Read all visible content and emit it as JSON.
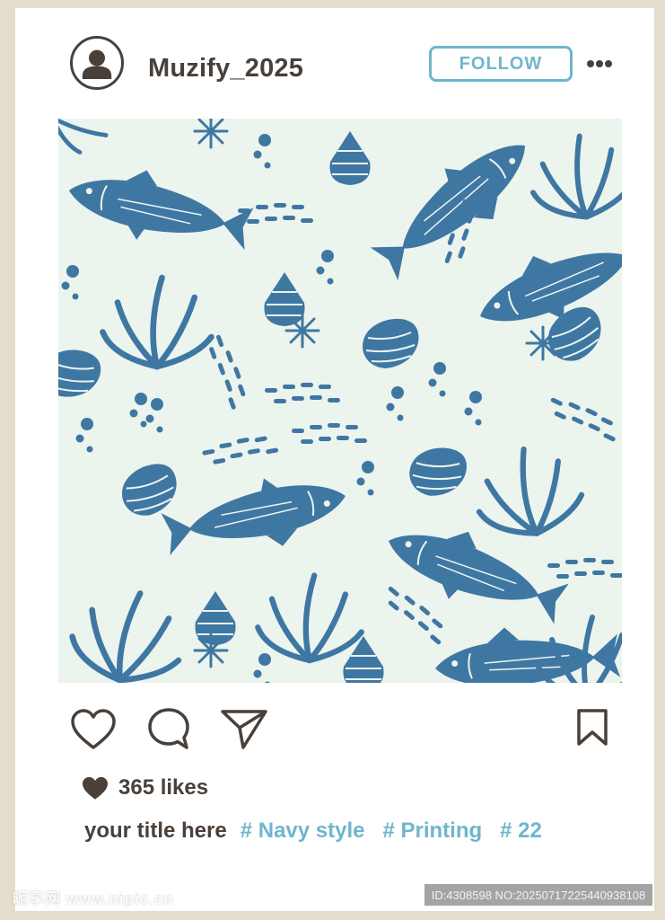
{
  "post": {
    "username": "Muzify_2025",
    "follow_label": "FOLLOW",
    "likes": "365 likes",
    "caption_title": "your title here",
    "hashtags": [
      "# Navy style",
      "# Printing",
      "# 22"
    ]
  },
  "icons": {
    "avatar": "user-avatar-icon",
    "more": "more-dots-icon",
    "like": "heart-outline-icon",
    "comment": "speech-bubble-icon",
    "share": "paper-plane-icon",
    "save": "bookmark-icon",
    "likes_heart": "heart-filled-icon"
  },
  "watermark": {
    "site": "昵享网 www.nipic.cn",
    "id_text": "ID:4308598 NO:20250717225440938108"
  },
  "colors": {
    "frame": "#e4dccd",
    "text_dark": "#4a403a",
    "accent_blue": "#6fb6cd",
    "pattern_bg": "#ecf4ee",
    "pattern_navy": "#3f77a3"
  }
}
